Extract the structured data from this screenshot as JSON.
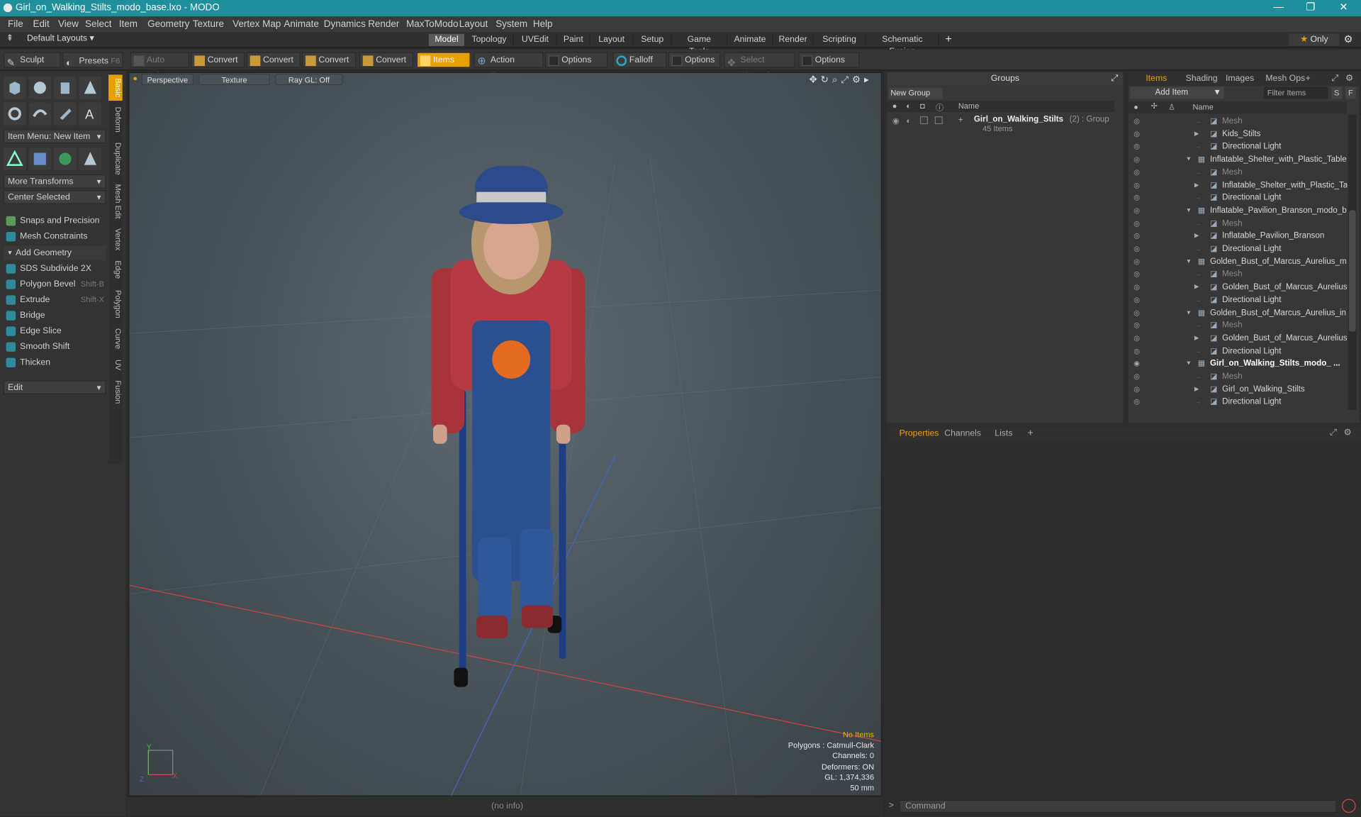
{
  "window": {
    "title": "Girl_on_Walking_Stilts_modo_base.lxo - MODO"
  },
  "menu": [
    "File",
    "Edit",
    "View",
    "Select",
    "Item",
    "Geometry",
    "Texture",
    "Vertex Map",
    "Animate",
    "Dynamics",
    "Render",
    "MaxToModo",
    "Layout",
    "System",
    "Help"
  ],
  "layout_selector": "Default Layouts",
  "top_tabs": [
    "Model",
    "Topology",
    "UVEdit",
    "Paint",
    "Layout",
    "Setup",
    "Game Tools",
    "Animate",
    "Render",
    "Scripting",
    "Schematic Fusion"
  ],
  "top_active_tab": "Model",
  "only_label": "Only",
  "toolbar": {
    "sculpt": "Sculpt",
    "presets": "Presets",
    "presets_key": "F6",
    "auto_select": "Auto Select",
    "convert1": "Convert",
    "convert2": "Convert",
    "convert3": "Convert",
    "convert4": "Convert",
    "items": "Items",
    "action_center": "Action Center",
    "options1": "Options",
    "falloff": "Falloff",
    "options2": "Options",
    "select_through": "Select Through",
    "options3": "Options"
  },
  "left": {
    "item_menu": "Item Menu: New Item",
    "more_transforms": "More Transforms",
    "center_selected": "Center Selected",
    "snaps": "Snaps and Precision",
    "constraints": "Mesh Constraints",
    "add_geometry": "Add Geometry",
    "tools": [
      {
        "label": "SDS Subdivide 2X",
        "key": ""
      },
      {
        "label": "Polygon Bevel",
        "key": "Shift-B"
      },
      {
        "label": "Extrude",
        "key": "Shift-X"
      },
      {
        "label": "Bridge",
        "key": ""
      },
      {
        "label": "Edge Slice",
        "key": ""
      },
      {
        "label": "Smooth Shift",
        "key": ""
      },
      {
        "label": "Thicken",
        "key": ""
      }
    ],
    "edit": "Edit",
    "vtabs": [
      "Basic",
      "Deform",
      "Duplicate",
      "Mesh Edit",
      "Vertex",
      "Edge",
      "Polygon",
      "Curve",
      "UV",
      "Fusion"
    ]
  },
  "viewport": {
    "perspective": "Perspective",
    "texture": "Texture",
    "raygl": "Ray GL: Off",
    "info": {
      "no_items": "No Items",
      "polygons": "Polygons : Catmull-Clark",
      "channels": "Channels: 0",
      "deformers": "Deformers: ON",
      "gl": "GL: 1,374,336",
      "mm": "50 mm"
    }
  },
  "status": "(no info)",
  "groups": {
    "title": "Groups",
    "new_group": "New Group",
    "name_col": "Name",
    "group_name": "Girl_on_Walking_Stilts",
    "group_count": "(2)",
    "group_type": ": Group",
    "group_items": "45 Items"
  },
  "items": {
    "tabs": [
      "Items",
      "Shading",
      "Images",
      "Mesh Ops"
    ],
    "add_item": "Add Item",
    "filter": "Filter Items",
    "s": "S",
    "f": "F",
    "name_col": "Name",
    "rows": [
      {
        "label": "Mesh",
        "indent": 2,
        "dim": true,
        "bold": false,
        "exp": ""
      },
      {
        "label": "Kids_Stilts",
        "indent": 2,
        "dim": false,
        "bold": false,
        "exp": "▶"
      },
      {
        "label": "Directional Light",
        "indent": 2,
        "dim": false,
        "bold": false,
        "exp": ""
      },
      {
        "label": "Inflatable_Shelter_with_Plastic_Table...",
        "indent": 1,
        "dim": false,
        "bold": false,
        "exp": "▼"
      },
      {
        "label": "Mesh",
        "indent": 2,
        "dim": true,
        "bold": false,
        "exp": ""
      },
      {
        "label": "Inflatable_Shelter_with_Plastic_Table",
        "indent": 2,
        "dim": false,
        "bold": false,
        "exp": "▶"
      },
      {
        "label": "Directional Light",
        "indent": 2,
        "dim": false,
        "bold": false,
        "exp": ""
      },
      {
        "label": "Inflatable_Pavilion_Branson_modo_b ...",
        "indent": 1,
        "dim": false,
        "bold": false,
        "exp": "▼"
      },
      {
        "label": "Mesh",
        "indent": 2,
        "dim": true,
        "bold": false,
        "exp": ""
      },
      {
        "label": "Inflatable_Pavilion_Branson",
        "indent": 2,
        "dim": false,
        "bold": false,
        "exp": "▶"
      },
      {
        "label": "Directional Light",
        "indent": 2,
        "dim": false,
        "bold": false,
        "exp": ""
      },
      {
        "label": "Golden_Bust_of_Marcus_Aurelius_m ...",
        "indent": 1,
        "dim": false,
        "bold": false,
        "exp": "▼"
      },
      {
        "label": "Mesh",
        "indent": 2,
        "dim": true,
        "bold": false,
        "exp": ""
      },
      {
        "label": "Golden_Bust_of_Marcus_Aurelius",
        "indent": 2,
        "dim": false,
        "bold": false,
        "exp": "▶"
      },
      {
        "label": "Directional Light",
        "indent": 2,
        "dim": false,
        "bold": false,
        "exp": ""
      },
      {
        "label": "Golden_Bust_of_Marcus_Aurelius_in ...",
        "indent": 1,
        "dim": false,
        "bold": false,
        "exp": "▼"
      },
      {
        "label": "Mesh",
        "indent": 2,
        "dim": true,
        "bold": false,
        "exp": ""
      },
      {
        "label": "Golden_Bust_of_Marcus_Aurelius_...",
        "indent": 2,
        "dim": false,
        "bold": false,
        "exp": "▶"
      },
      {
        "label": "Directional Light",
        "indent": 2,
        "dim": false,
        "bold": false,
        "exp": ""
      },
      {
        "label": "Girl_on_Walking_Stilts_modo_ ...",
        "indent": 1,
        "dim": false,
        "bold": true,
        "exp": "▼"
      },
      {
        "label": "Mesh",
        "indent": 2,
        "dim": true,
        "bold": false,
        "exp": ""
      },
      {
        "label": "Girl_on_Walking_Stilts",
        "indent": 2,
        "dim": false,
        "bold": false,
        "exp": "▶"
      },
      {
        "label": "Directional Light",
        "indent": 2,
        "dim": false,
        "bold": false,
        "exp": ""
      }
    ]
  },
  "bottom_tabs": [
    "Properties",
    "Channels",
    "Lists"
  ],
  "command_placeholder": "Command"
}
